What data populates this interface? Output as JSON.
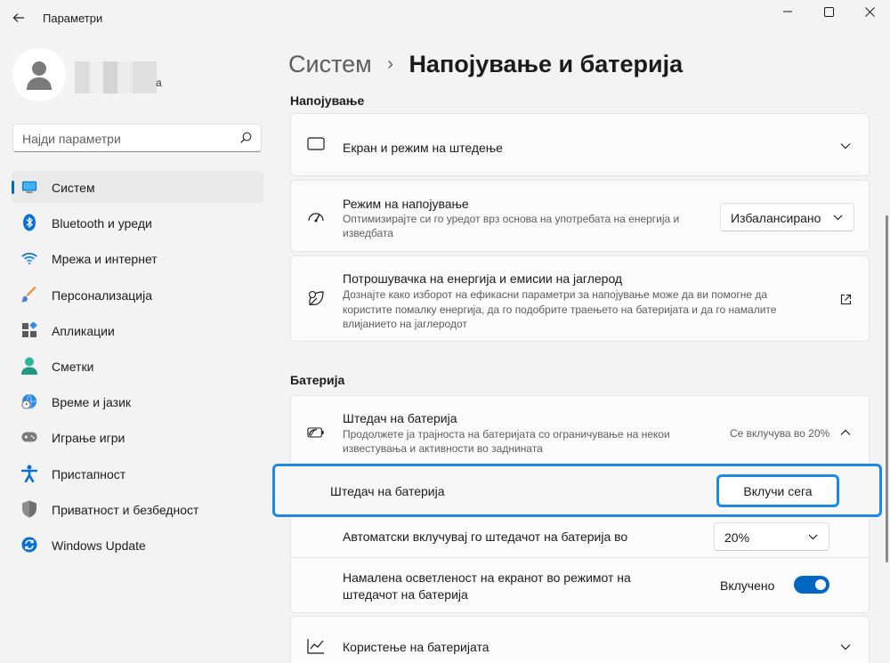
{
  "window": {
    "title": "Параметри",
    "controls": [
      "minimize-icon",
      "maximize-icon",
      "close-icon"
    ]
  },
  "profile": {
    "name_tail": "а"
  },
  "search": {
    "placeholder": "Најди параметри"
  },
  "nav": {
    "items": [
      {
        "label": "Систем",
        "icon": "system-icon",
        "active": true
      },
      {
        "label": "Bluetooth и уреди",
        "icon": "bluetooth-icon"
      },
      {
        "label": "Мрежа и интернет",
        "icon": "wifi-icon"
      },
      {
        "label": "Персонализација",
        "icon": "brush-icon"
      },
      {
        "label": "Апликации",
        "icon": "apps-icon"
      },
      {
        "label": "Сметки",
        "icon": "account-icon"
      },
      {
        "label": "Време и јазик",
        "icon": "globe-clock-icon"
      },
      {
        "label": "Играње игри",
        "icon": "gamepad-icon"
      },
      {
        "label": "Пристапност",
        "icon": "accessibility-icon"
      },
      {
        "label": "Приватност и безбедност",
        "icon": "shield-icon"
      },
      {
        "label": "Windows Update",
        "icon": "update-icon"
      }
    ]
  },
  "breadcrumb": {
    "parent": "Систем",
    "separator": "›",
    "current": "Напојување и батерија"
  },
  "sections": {
    "power": "Напојување",
    "battery": "Батерија"
  },
  "power": {
    "screen_sleep": {
      "title": "Екран и режим на штедење"
    },
    "power_mode": {
      "title": "Режим на напојување",
      "desc_line1": "Оптимизирајте си го уредот врз основа на употребата на енергија и",
      "desc_line2": "изведбата",
      "value": "Избалансирано"
    },
    "consumption": {
      "title": "Потрошувачка на енергија и емисии на јаглерод",
      "desc_line1": "Дознајте како изборот на ефикасни параметри за напојување може да ви помогне да",
      "desc_line2": "користите помалку енергија, да го подобрите траењето на батеријата и да го намалите",
      "desc_line3": "влијанието на јаглеродот"
    }
  },
  "battery": {
    "saver": {
      "title": "Штедач на батерија",
      "desc_line1": "Продолжете ја трајноста на батеријата со ограничување на некои",
      "desc_line2": "известувања и активности во заднината",
      "status": "Се вклучува во 20%"
    },
    "saver_row": {
      "label": "Штедач на батерија",
      "button": "Вклучи сега"
    },
    "auto_on": {
      "label": "Автоматски вклучувај го штедачот на батерија во",
      "value": "20%"
    },
    "brightness": {
      "label_line1": "Намалена осветленост на екранот во режимот на",
      "label_line2": "штедачот на батерија",
      "state": "Вклучено",
      "on": true
    },
    "usage": {
      "title": "Користење на батеријата"
    }
  },
  "colors": {
    "accent": "#0067c0",
    "highlight": "#1e88e5"
  }
}
